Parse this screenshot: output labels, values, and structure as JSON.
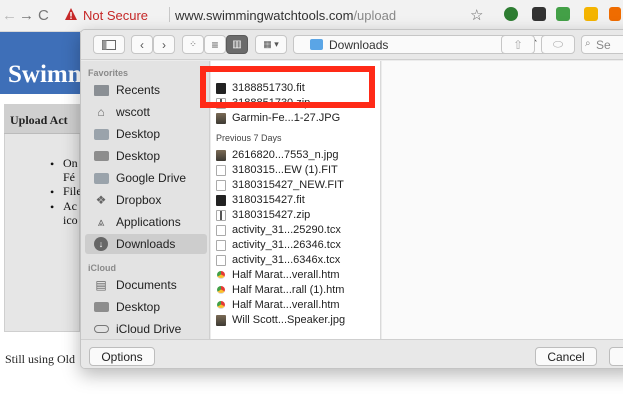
{
  "browser": {
    "not_secure": "Not Secure",
    "url_host": "www.swimmingwatchtools.com",
    "url_path": "/upload"
  },
  "site": {
    "title": "Swimm",
    "panel_title": "Upload Act",
    "list_items": [
      "On",
      "Fé",
      "File",
      "Ac",
      "ico"
    ],
    "footer_text": "Still using Old"
  },
  "dialog": {
    "location": "Downloads",
    "search_placeholder": "Se",
    "options_label": "Options",
    "cancel_label": "Cancel",
    "sidebar": {
      "favorites_heading": "Favorites",
      "favorites": [
        {
          "label": "Recents",
          "icon": "recents-icon"
        },
        {
          "label": "wscott",
          "icon": "home-icon"
        },
        {
          "label": "Desktop",
          "icon": "folder-icon"
        },
        {
          "label": "Desktop",
          "icon": "drive-icon"
        },
        {
          "label": "Google Drive",
          "icon": "folder-icon"
        },
        {
          "label": "Dropbox",
          "icon": "dropbox-icon"
        },
        {
          "label": "Applications",
          "icon": "applications-icon"
        },
        {
          "label": "Downloads",
          "icon": "downloads-icon"
        }
      ],
      "icloud_heading": "iCloud",
      "icloud": [
        {
          "label": "Documents",
          "icon": "documents-icon"
        },
        {
          "label": "Desktop",
          "icon": "drive-icon"
        },
        {
          "label": "iCloud Drive",
          "icon": "cloud-icon"
        }
      ]
    },
    "files": {
      "recent": [
        {
          "name": "3188851730.fit",
          "type": "fit"
        },
        {
          "name": "3188851730.zip",
          "type": "zip"
        },
        {
          "name": "Garmin-Fe...1-27.JPG",
          "type": "img"
        }
      ],
      "previous_heading": "Previous 7 Days",
      "previous": [
        {
          "name": "2616820...7553_n.jpg",
          "type": "img"
        },
        {
          "name": "3180315...EW (1).FIT",
          "type": "doc"
        },
        {
          "name": "3180315427_NEW.FIT",
          "type": "doc"
        },
        {
          "name": "3180315427.fit",
          "type": "fit"
        },
        {
          "name": "3180315427.zip",
          "type": "zip"
        },
        {
          "name": "activity_31...25290.tcx",
          "type": "doc"
        },
        {
          "name": "activity_31...26346.tcx",
          "type": "doc"
        },
        {
          "name": "activity_31...6346x.tcx",
          "type": "doc"
        },
        {
          "name": "Half Marat...verall.htm",
          "type": "chrome"
        },
        {
          "name": "Half Marat...rall (1).htm",
          "type": "chrome"
        },
        {
          "name": "Half Marat...verall.htm",
          "type": "chrome"
        },
        {
          "name": "Will Scott...Speaker.jpg",
          "type": "img"
        }
      ]
    }
  },
  "colors": {
    "highlight": "#ff2a17",
    "site_header": "#3e6fb8",
    "not_secure": "#c62828"
  }
}
